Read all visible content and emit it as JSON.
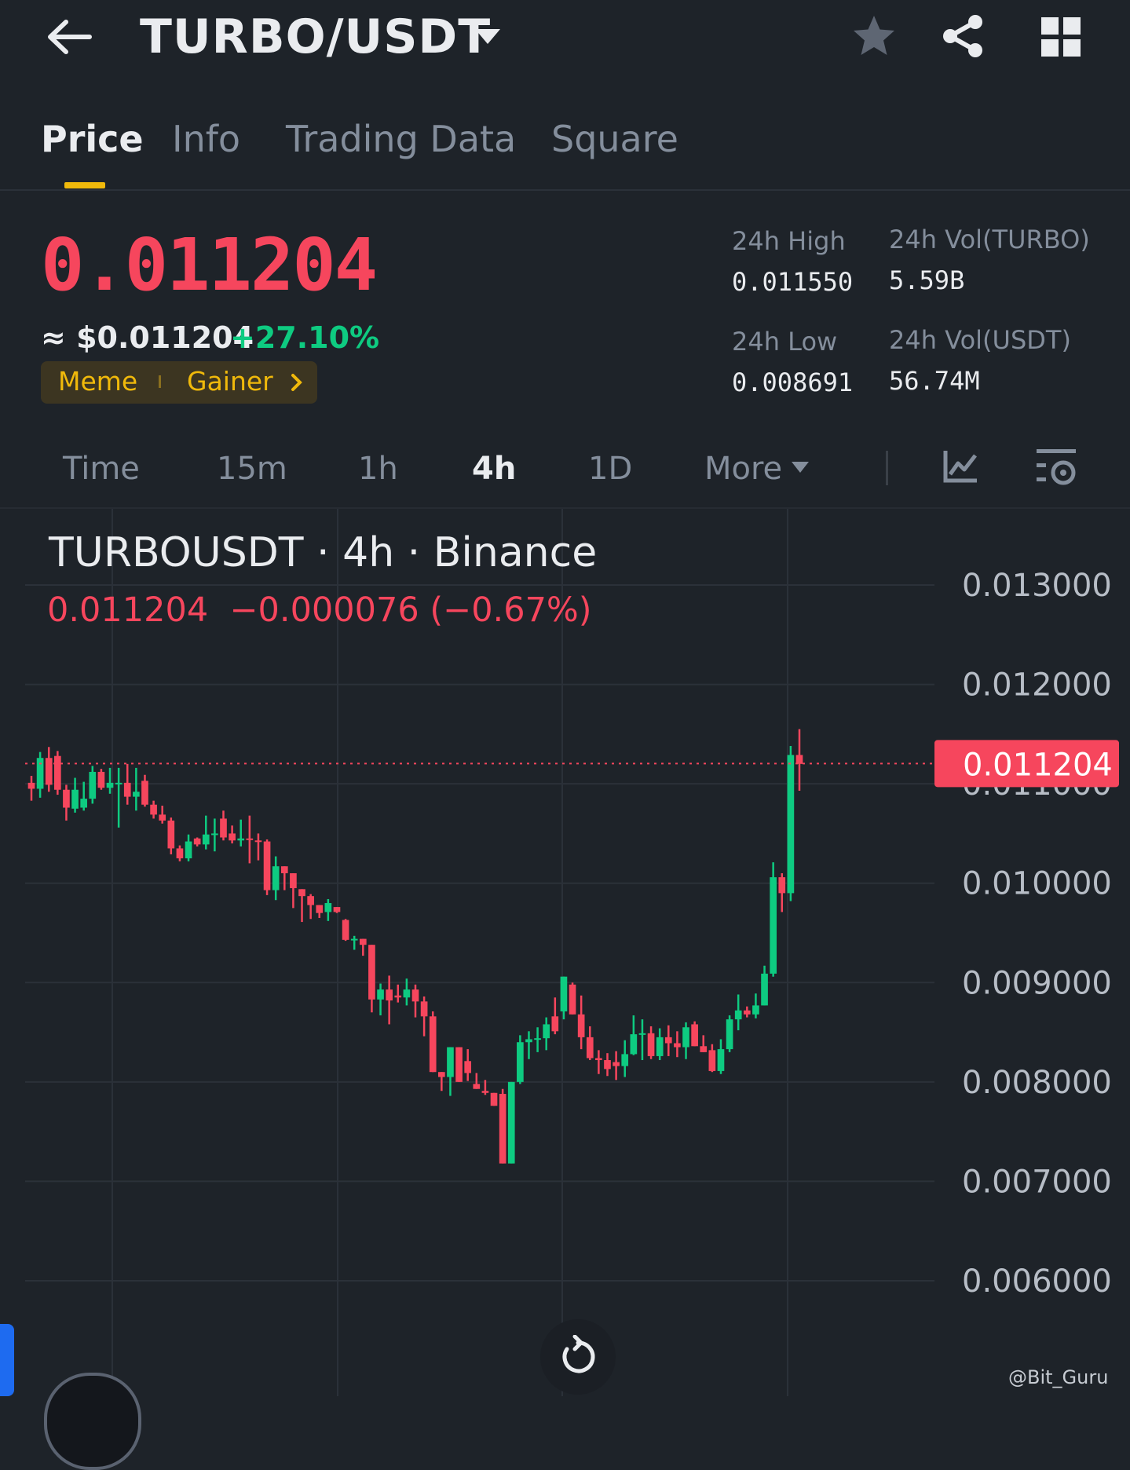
{
  "header": {
    "pair": "TURBO/USDT",
    "icons": [
      "back-arrow-icon",
      "caret-down-icon",
      "star-icon",
      "share-icon",
      "grid-icon"
    ]
  },
  "tabs": [
    {
      "label": "Price",
      "active": true
    },
    {
      "label": "Info",
      "active": false
    },
    {
      "label": "Trading Data",
      "active": false
    },
    {
      "label": "Square",
      "active": false
    }
  ],
  "price": {
    "last": "0.011204",
    "usd": "≈ $0.011204",
    "change_pct": "+27.10%",
    "tags": [
      "Meme",
      "Gainer"
    ]
  },
  "stats": {
    "high_label": "24h High",
    "high_value": "0.011550",
    "low_label": "24h Low",
    "low_value": "0.008691",
    "vol_base_label": "24h Vol(TURBO)",
    "vol_base_value": "5.59B",
    "vol_quote_label": "24h Vol(USDT)",
    "vol_quote_value": "56.74M"
  },
  "intervals": [
    {
      "label": "Time",
      "active": false
    },
    {
      "label": "15m",
      "active": false
    },
    {
      "label": "1h",
      "active": false
    },
    {
      "label": "4h",
      "active": true
    },
    {
      "label": "1D",
      "active": false
    },
    {
      "label": "More",
      "active": false
    }
  ],
  "chart": {
    "title": "TURBOUSDT · 4h · Binance",
    "ohlc_line": "0.011204  −0.000076 (−0.67%)",
    "current_price_label": "0.011204",
    "watermark": "@Bit_Guru"
  },
  "colors": {
    "background": "#1e2329",
    "up": "#0ecb81",
    "down": "#f6465d",
    "accent": "#f0b90b",
    "muted_text": "#848e9c"
  },
  "chart_data": {
    "type": "candlestick",
    "title": "TURBOUSDT · 4h · Binance",
    "y_ticks": [
      "0.013000",
      "0.012000",
      "0.011000",
      "0.010000",
      "0.009000",
      "0.008000",
      "0.007000",
      "0.006000"
    ],
    "ylim": [
      0.0058,
      0.0136
    ],
    "last_price": 0.011204,
    "candles": [
      [
        0.01101,
        0.01108,
        0.01083,
        0.01095
      ],
      [
        0.01095,
        0.01132,
        0.01086,
        0.01126
      ],
      [
        0.01126,
        0.01137,
        0.01092,
        0.01099
      ],
      [
        0.01128,
        0.01133,
        0.01089,
        0.01094
      ],
      [
        0.01094,
        0.01099,
        0.01063,
        0.01076
      ],
      [
        0.01075,
        0.01106,
        0.01071,
        0.01094
      ],
      [
        0.01076,
        0.01102,
        0.01073,
        0.01085
      ],
      [
        0.01085,
        0.01118,
        0.0108,
        0.01112
      ],
      [
        0.01112,
        0.01115,
        0.01094,
        0.01096
      ],
      [
        0.01096,
        0.01116,
        0.0109,
        0.01101
      ],
      [
        0.01101,
        0.01116,
        0.01056,
        0.01101
      ],
      [
        0.01101,
        0.0112,
        0.01079,
        0.01087
      ],
      [
        0.01087,
        0.01116,
        0.01073,
        0.01092
      ],
      [
        0.01103,
        0.01109,
        0.01077,
        0.01079
      ],
      [
        0.01079,
        0.01083,
        0.01065,
        0.01069
      ],
      [
        0.01069,
        0.01078,
        0.0106,
        0.01063
      ],
      [
        0.01063,
        0.01066,
        0.01029,
        0.01035
      ],
      [
        0.01035,
        0.01038,
        0.01022,
        0.01025
      ],
      [
        0.01025,
        0.01049,
        0.01022,
        0.01042
      ],
      [
        0.01045,
        0.01046,
        0.01037,
        0.01039
      ],
      [
        0.01039,
        0.01068,
        0.01034,
        0.01049
      ],
      [
        0.01049,
        0.01065,
        0.01032,
        0.0105
      ],
      [
        0.01065,
        0.01073,
        0.01043,
        0.01046
      ],
      [
        0.0105,
        0.01058,
        0.0104,
        0.01043
      ],
      [
        0.01043,
        0.01064,
        0.01037,
        0.01045
      ],
      [
        0.01045,
        0.01068,
        0.0102,
        0.01044
      ],
      [
        0.01043,
        0.0105,
        0.01023,
        0.01042
      ],
      [
        0.01042,
        0.01044,
        0.00988,
        0.00993
      ],
      [
        0.00993,
        0.01027,
        0.00983,
        0.01017
      ],
      [
        0.01017,
        0.01014,
        0.00993,
        0.0101
      ],
      [
        0.0101,
        0.01006,
        0.00975,
        0.00995
      ],
      [
        0.00994,
        0.00993,
        0.00961,
        0.00987
      ],
      [
        0.00987,
        0.00989,
        0.00964,
        0.00978
      ],
      [
        0.00978,
        0.00974,
        0.00965,
        0.0097
      ],
      [
        0.00971,
        0.00984,
        0.00962,
        0.0098
      ],
      [
        0.00976,
        0.00972,
        0.0097,
        0.00971
      ],
      [
        0.00963,
        0.00964,
        0.00942,
        0.00943
      ],
      [
        0.00943,
        0.00947,
        0.00933,
        0.00944
      ],
      [
        0.00944,
        0.00942,
        0.00927,
        0.00938
      ],
      [
        0.00938,
        0.00937,
        0.0087,
        0.00883
      ],
      [
        0.00883,
        0.00899,
        0.00867,
        0.00893
      ],
      [
        0.00893,
        0.00907,
        0.00858,
        0.00882
      ],
      [
        0.00887,
        0.00898,
        0.0088,
        0.00885
      ],
      [
        0.00885,
        0.00904,
        0.00877,
        0.00893
      ],
      [
        0.00893,
        0.00898,
        0.00865,
        0.00881
      ],
      [
        0.00881,
        0.00886,
        0.00846,
        0.00866
      ],
      [
        0.00866,
        0.00871,
        0.00811,
        0.0081
      ],
      [
        0.0081,
        0.00806,
        0.00791,
        0.00805
      ],
      [
        0.00805,
        0.00789,
        0.00786,
        0.00835
      ],
      [
        0.00835,
        0.00822,
        0.00831,
        0.008
      ],
      [
        0.00821,
        0.00833,
        0.00801,
        0.00809
      ],
      [
        0.00798,
        0.00809,
        0.00801,
        0.00793
      ],
      [
        0.00791,
        0.00802,
        0.00787,
        0.00789
      ],
      [
        0.00789,
        0.00788,
        0.00776,
        0.00776
      ],
      [
        0.00788,
        0.00793,
        0.00728,
        0.00718
      ],
      [
        0.00718,
        0.0073,
        0.0078,
        0.008
      ],
      [
        0.008,
        0.00847,
        0.00798,
        0.0084
      ],
      [
        0.0084,
        0.00851,
        0.00823,
        0.00843
      ],
      [
        0.00843,
        0.00855,
        0.0083,
        0.00844
      ],
      [
        0.00844,
        0.00865,
        0.00832,
        0.00858
      ],
      [
        0.00866,
        0.00885,
        0.00848,
        0.00851
      ],
      [
        0.00871,
        0.00906,
        0.00863,
        0.00906
      ],
      [
        0.00898,
        0.009,
        0.00872,
        0.00868
      ],
      [
        0.00868,
        0.00887,
        0.00833,
        0.00845
      ],
      [
        0.00845,
        0.00856,
        0.00822,
        0.00824
      ],
      [
        0.00824,
        0.00832,
        0.00808,
        0.00822
      ],
      [
        0.00822,
        0.00829,
        0.00806,
        0.00813
      ],
      [
        0.0082,
        0.00831,
        0.00802,
        0.00816
      ],
      [
        0.00816,
        0.00842,
        0.00805,
        0.00828
      ],
      [
        0.00828,
        0.00867,
        0.00827,
        0.00848
      ],
      [
        0.00848,
        0.00863,
        0.00822,
        0.00849
      ],
      [
        0.00849,
        0.00856,
        0.00823,
        0.00826
      ],
      [
        0.00826,
        0.00854,
        0.00822,
        0.00845
      ],
      [
        0.00845,
        0.00857,
        0.00826,
        0.00839
      ],
      [
        0.00839,
        0.00851,
        0.00825,
        0.00835
      ],
      [
        0.00835,
        0.0086,
        0.00823,
        0.00855
      ],
      [
        0.00858,
        0.00861,
        0.00838,
        0.00836
      ],
      [
        0.00836,
        0.00847,
        0.00832,
        0.0083
      ],
      [
        0.00832,
        0.00838,
        0.0081,
        0.00811
      ],
      [
        0.00811,
        0.00843,
        0.00808,
        0.00833
      ],
      [
        0.00833,
        0.00867,
        0.0083,
        0.00863
      ],
      [
        0.00863,
        0.00888,
        0.00852,
        0.00872
      ],
      [
        0.00872,
        0.00876,
        0.00865,
        0.00868
      ],
      [
        0.00868,
        0.00889,
        0.00864,
        0.00877
      ],
      [
        0.00877,
        0.00917,
        0.00877,
        0.00909
      ],
      [
        0.00909,
        0.01021,
        0.00906,
        0.01006
      ],
      [
        0.01006,
        0.0101,
        0.00971,
        0.0099
      ],
      [
        0.0099,
        0.01138,
        0.00982,
        0.01129
      ],
      [
        0.01129,
        0.01155,
        0.01093,
        0.0112
      ]
    ]
  }
}
